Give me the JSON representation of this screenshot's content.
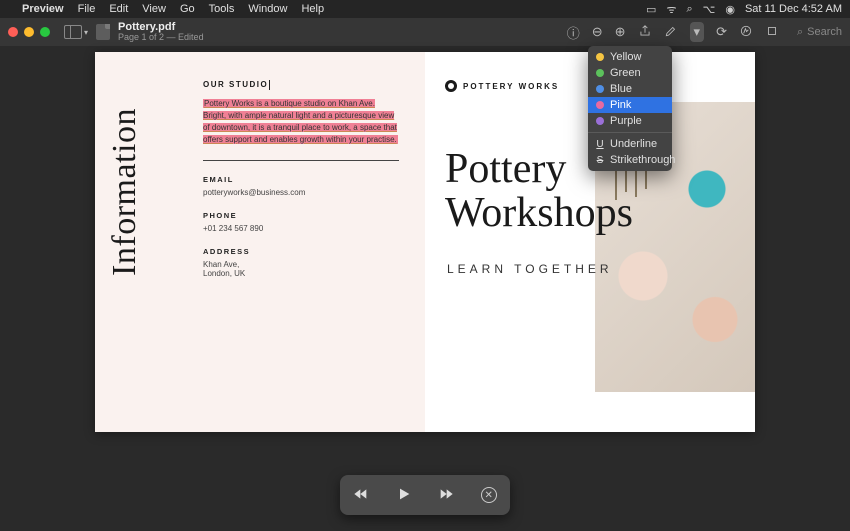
{
  "menubar": {
    "app": "Preview",
    "items": [
      "File",
      "Edit",
      "View",
      "Go",
      "Tools",
      "Window",
      "Help"
    ],
    "datetime": "Sat 11 Dec 4:52 AM"
  },
  "window": {
    "title": "Pottery.pdf",
    "subtitle": "Page 1 of 2 — Edited",
    "search_placeholder": "Search"
  },
  "highlight_menu": {
    "colors": [
      {
        "label": "Yellow",
        "hex": "#f5c542"
      },
      {
        "label": "Green",
        "hex": "#5cc15c"
      },
      {
        "label": "Blue",
        "hex": "#4f8fe6"
      },
      {
        "label": "Pink",
        "hex": "#e86aa0"
      },
      {
        "label": "Purple",
        "hex": "#9a6fd8"
      }
    ],
    "selected": "Pink",
    "styles": [
      {
        "sym": "U",
        "label": "Underline"
      },
      {
        "sym": "S",
        "label": "Strikethrough"
      }
    ]
  },
  "doc": {
    "info_heading": "Information",
    "studio_h": "OUR STUDIO",
    "studio_p": "Pottery Works is a boutique studio on Khan Ave. Bright, with ample natural light and a picturesque view of downtown, it is a tranquil place to work, a space that offers support and enables growth within your practise.",
    "email_h": "EMAIL",
    "email_v": "potteryworks@business.com",
    "phone_h": "PHONE",
    "phone_v": "+01 234 567 890",
    "addr_h": "ADDRESS",
    "addr_l1": "Khan Ave,",
    "addr_l2": "London, UK",
    "brand": "POTTERY WORKS",
    "headline_1": "Pottery",
    "headline_2": "Workshops",
    "subhead": "LEARN TOGETHER"
  }
}
